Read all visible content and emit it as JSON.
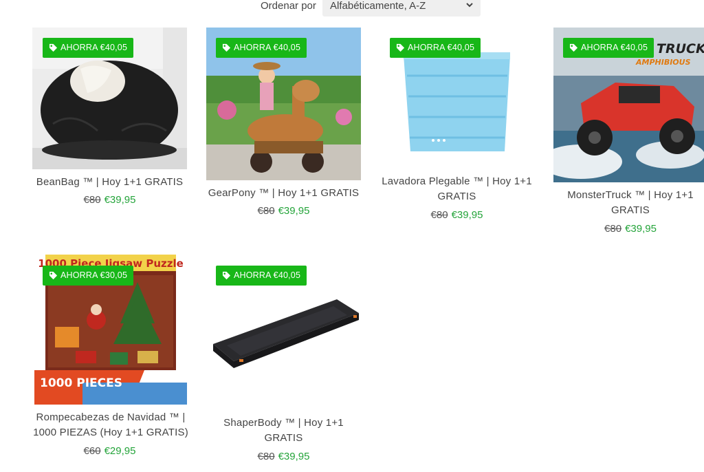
{
  "sort": {
    "label": "Ordenar por",
    "selected": "Alfabéticamente, A-Z"
  },
  "products": [
    {
      "name": "BeanBag ™ | Hoy 1+1 GRATIS",
      "badge": "AHORRA €40,05",
      "old_price": "€80",
      "price": "€39,95",
      "image": "bean-bag-photo"
    },
    {
      "name": "GearPony ™ | Hoy 1+1 GRATIS",
      "badge": "AHORRA €40,05",
      "old_price": "€80",
      "price": "€39,95",
      "image": "kid-on-toy-pony-photo"
    },
    {
      "name": "Lavadora Plegable ™ | Hoy 1+1 GRATIS",
      "badge": "AHORRA €40,05",
      "old_price": "€80",
      "price": "€39,95",
      "image": "foldable-washer-photo"
    },
    {
      "name": "MonsterTruck ™ | Hoy 1+1 GRATIS",
      "badge": "AHORRA €40,05",
      "old_price": "€80",
      "price": "€39,95",
      "image": "rc-truck-photo",
      "image_text": "TRUCK",
      "image_subtext": "AMPHIBIOUS"
    },
    {
      "name": "Rompecabezas de Navidad ™ | 1000 PIEZAS (Hoy 1+1 GRATIS)",
      "badge": "AHORRA €30,05",
      "old_price": "€60",
      "price": "€29,95",
      "image": "christmas-puzzle-photo",
      "image_text": "1000 Piece Jigsaw Puzzle",
      "image_subtext": "1000 PIECES"
    },
    {
      "name": "ShaperBody ™ | Hoy 1+1 GRATIS",
      "badge": "AHORRA €40,05",
      "old_price": "€80",
      "price": "€39,95",
      "image": "walking-pad-photo"
    }
  ],
  "colors": {
    "badge": "#18b718",
    "sale_price": "#24a43a",
    "sort_bg": "#efefef"
  }
}
